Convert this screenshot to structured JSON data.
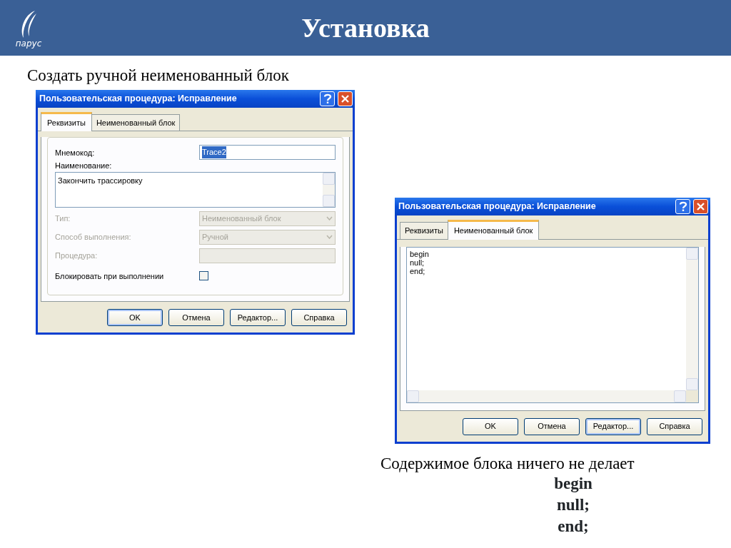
{
  "slide": {
    "title": "Установка",
    "logo_text": "парус"
  },
  "left_caption": "Создать ручной неименованный блок",
  "dialogs": [
    {
      "kind": "form",
      "title": "Пользовательская процедура: Исправление",
      "tabs": [
        {
          "label": "Реквизиты",
          "selected": true
        },
        {
          "label": "Неименованный блок",
          "selected": false
        }
      ],
      "fields": [
        {
          "kind": "text",
          "label": "Мнемокод:",
          "value": "Trace2",
          "text_selected": true,
          "disabled": false
        },
        {
          "kind": "memo",
          "label": "Наименование:",
          "value": "Закончить  трассировку"
        },
        {
          "kind": "select",
          "label": "Тип:",
          "value": "Неименованный блок",
          "disabled": true
        },
        {
          "kind": "select",
          "label": "Способ выполнения:",
          "value": "Ручной",
          "disabled": true
        },
        {
          "kind": "text",
          "label": "Процедура:",
          "disabled": true
        },
        {
          "kind": "checkbox",
          "label": "Блокировать при выполнении",
          "checked": false
        }
      ],
      "buttons": [
        {
          "label": "OK",
          "focused": true
        },
        {
          "label": "Отмена",
          "focused": false
        },
        {
          "label": "Редактор...",
          "focused": false
        },
        {
          "label": "Справка",
          "focused": false
        }
      ]
    },
    {
      "kind": "code",
      "title": "Пользовательская процедура: Исправление",
      "tabs": [
        {
          "label": "Реквизиты",
          "selected": false
        },
        {
          "label": "Неименованный блок",
          "selected": true
        }
      ],
      "code_lines": [
        "begin",
        "null;",
        "end;"
      ],
      "buttons": [
        {
          "label": "OK",
          "focused": false
        },
        {
          "label": "Отмена",
          "focused": false
        },
        {
          "label": "Редактор...",
          "focused": true
        },
        {
          "label": "Справка",
          "focused": false
        }
      ]
    }
  ],
  "right_caption": "Содержимое блока ничего не делает",
  "code_lines": [
    "begin",
    "null;",
    "end;"
  ]
}
